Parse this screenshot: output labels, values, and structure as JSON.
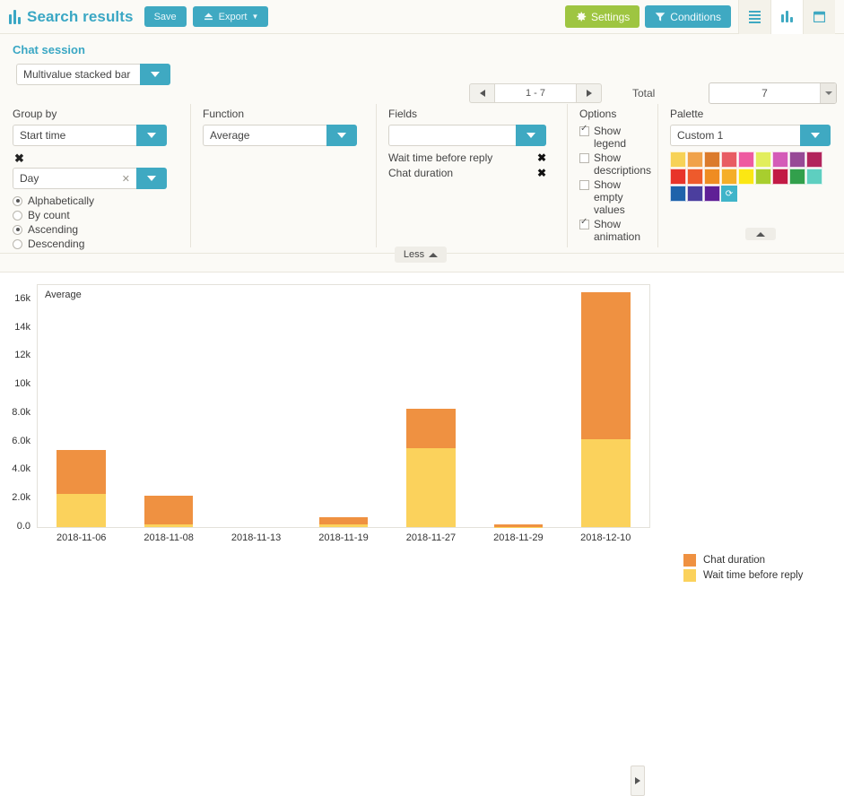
{
  "toolbar": {
    "brand_icon": "bar-chart-icon",
    "title": "Search results",
    "save_label": "Save",
    "export_label": "Export",
    "export_icon": "upload-icon",
    "settings_label": "Settings",
    "settings_icon": "gear-icon",
    "conditions_label": "Conditions",
    "conditions_icon": "filter-icon",
    "view_list_icon": "list-view-icon",
    "view_chart_icon": "chart-view-icon",
    "view_calendar_icon": "calendar-view-icon",
    "settings_color": "#9ec541",
    "accent_color": "#3fa9c2"
  },
  "session": {
    "title": "Chat session",
    "chart_type": "Multivalue stacked bar",
    "pager": {
      "prev_icon": "chevron-left-icon",
      "range": "1 - 7",
      "next_icon": "chevron-right-icon"
    },
    "total_label": "Total",
    "total_value": "7"
  },
  "group_by": {
    "label": "Group by",
    "field": "Start time",
    "remove_icon": "remove-x-icon",
    "interval": "Day",
    "interval_clear_icon": "clear-x-icon",
    "sort_options": [
      {
        "label": "Alphabetically",
        "selected": true
      },
      {
        "label": "By count",
        "selected": false
      },
      {
        "label": "Ascending",
        "selected": true
      },
      {
        "label": "Descending",
        "selected": false
      }
    ]
  },
  "function": {
    "label": "Function",
    "value": "Average"
  },
  "fields": {
    "label": "Fields",
    "value": "",
    "items": [
      {
        "label": "Wait time before reply",
        "remove_icon": "remove-x-icon"
      },
      {
        "label": "Chat duration",
        "remove_icon": "remove-x-icon"
      }
    ]
  },
  "options": {
    "label": "Options",
    "items": [
      {
        "label": "Show legend",
        "checked": true
      },
      {
        "label": "Show descriptions",
        "checked": false
      },
      {
        "label": "Show empty values",
        "checked": false
      },
      {
        "label": "Show animation",
        "checked": true
      }
    ]
  },
  "palette": {
    "label": "Palette",
    "value": "Custom 1",
    "refresh_icon": "refresh-icon",
    "collapse_icon": "collapse-up-icon",
    "colors": [
      "#f7d257",
      "#f0a24b",
      "#db7b2c",
      "#e85c63",
      "#ee5ba0",
      "#e2ee5c",
      "#d45bb8",
      "#974a96",
      "#b2255c",
      "#e8342a",
      "#ee5a2c",
      "#ef8c22",
      "#f5ae28",
      "#fbe713",
      "#a8ce2e",
      "#c21a45",
      "#32a04c",
      "#5ecfc0",
      "#1f63ab",
      "#4b3e9e",
      "#5f1f96"
    ]
  },
  "less_button": {
    "label": "Less",
    "icon": "chevron-up-icon"
  },
  "chart_data": {
    "type": "bar",
    "title": "Average",
    "xlabel": "",
    "ylabel": "",
    "grid": false,
    "legend_position": "right",
    "ylim": [
      0,
      17000
    ],
    "ytick_labels": [
      "0.0",
      "2.0k",
      "4.0k",
      "6.0k",
      "8.0k",
      "10k",
      "12k",
      "14k",
      "16k"
    ],
    "ytick_values": [
      0,
      2000,
      4000,
      6000,
      8000,
      10000,
      12000,
      14000,
      16000
    ],
    "categories": [
      "2018-11-06",
      "2018-11-08",
      "2018-11-13",
      "2018-11-19",
      "2018-11-27",
      "2018-11-29",
      "2018-12-10"
    ],
    "stacked": true,
    "series": [
      {
        "name": "Wait time before reply",
        "color": "#fbd25c",
        "values": [
          2300,
          180,
          0,
          220,
          5550,
          20,
          6200
        ]
      },
      {
        "name": "Chat duration",
        "color": "#ef9141",
        "values": [
          3100,
          2030,
          0,
          460,
          2750,
          150,
          10300
        ]
      }
    ],
    "scroll_right_icon": "scroll-right-icon"
  }
}
